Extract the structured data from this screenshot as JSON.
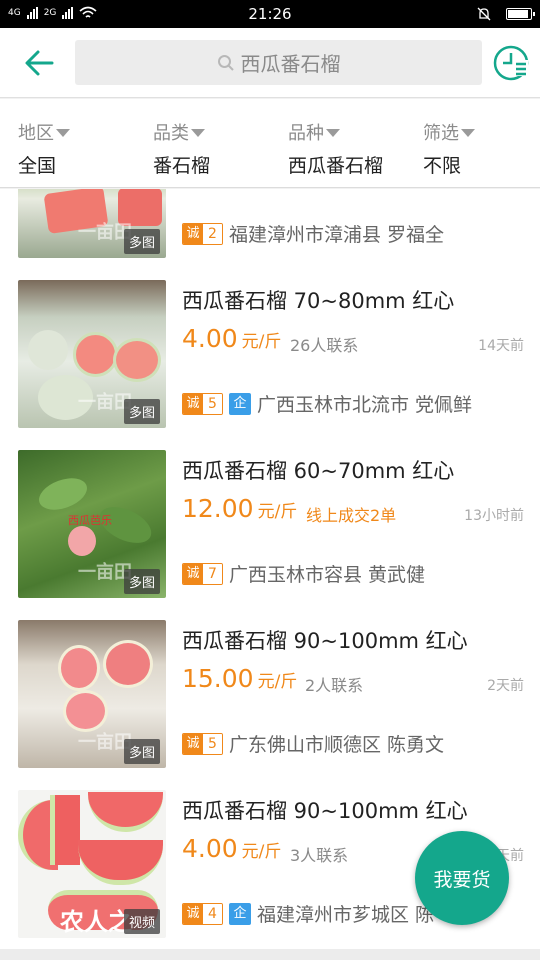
{
  "status_bar": {
    "left": [
      "4G",
      "2G"
    ],
    "time": "21:26"
  },
  "header": {
    "search_text": "西瓜番石榴",
    "icons": {
      "back": "back-arrow-icon",
      "history": "history-list-icon",
      "search": "search-icon"
    },
    "accent_color": "#14a78c"
  },
  "filters": [
    {
      "label": "地区",
      "value": "全国"
    },
    {
      "label": "品类",
      "value": "番石榴"
    },
    {
      "label": "品种",
      "value": "西瓜番石榴"
    },
    {
      "label": "筛选",
      "value": "不限"
    }
  ],
  "listings": [
    {
      "title": "",
      "price": "",
      "unit": "",
      "contacts": "",
      "time": "",
      "credit_label": "诚",
      "credit_level": "2",
      "enterprise": false,
      "seller": "福建漳州市漳浦县 罗福全",
      "badge": "多图"
    },
    {
      "title": "西瓜番石榴 70~80mm 红心",
      "price": "4.00",
      "unit": "元/斤",
      "contacts": "26人联系",
      "time": "14天前",
      "credit_label": "诚",
      "credit_level": "5",
      "enterprise": true,
      "seller": "广西玉林市北流市 党佩鲜",
      "badge": "多图"
    },
    {
      "title": "西瓜番石榴 60~70mm 红心",
      "price": "12.00",
      "unit": "元/斤",
      "contacts": "线上成交2单",
      "time": "13小时前",
      "credit_label": "诚",
      "credit_level": "7",
      "enterprise": false,
      "seller": "广西玉林市容县 黄武健",
      "badge": "多图",
      "thumb_text": "西瓜芭乐"
    },
    {
      "title": "西瓜番石榴 90~100mm 红心",
      "price": "15.00",
      "unit": "元/斤",
      "contacts": "2人联系",
      "time": "2天前",
      "credit_label": "诚",
      "credit_level": "5",
      "enterprise": false,
      "seller": "广东佛山市顺德区 陈勇文",
      "badge": "多图"
    },
    {
      "title": "西瓜番石榴 90~100mm 红心",
      "price": "4.00",
      "unit": "元/斤",
      "contacts": "3人联系",
      "time": "天前",
      "credit_label": "诚",
      "credit_level": "4",
      "enterprise": true,
      "seller": "福建漳州市芗城区 陈",
      "badge": "视频",
      "thumb_text": "农人之"
    }
  ],
  "enterprise_label": "企",
  "watermark": "一亩田",
  "fab_label": "我要货"
}
